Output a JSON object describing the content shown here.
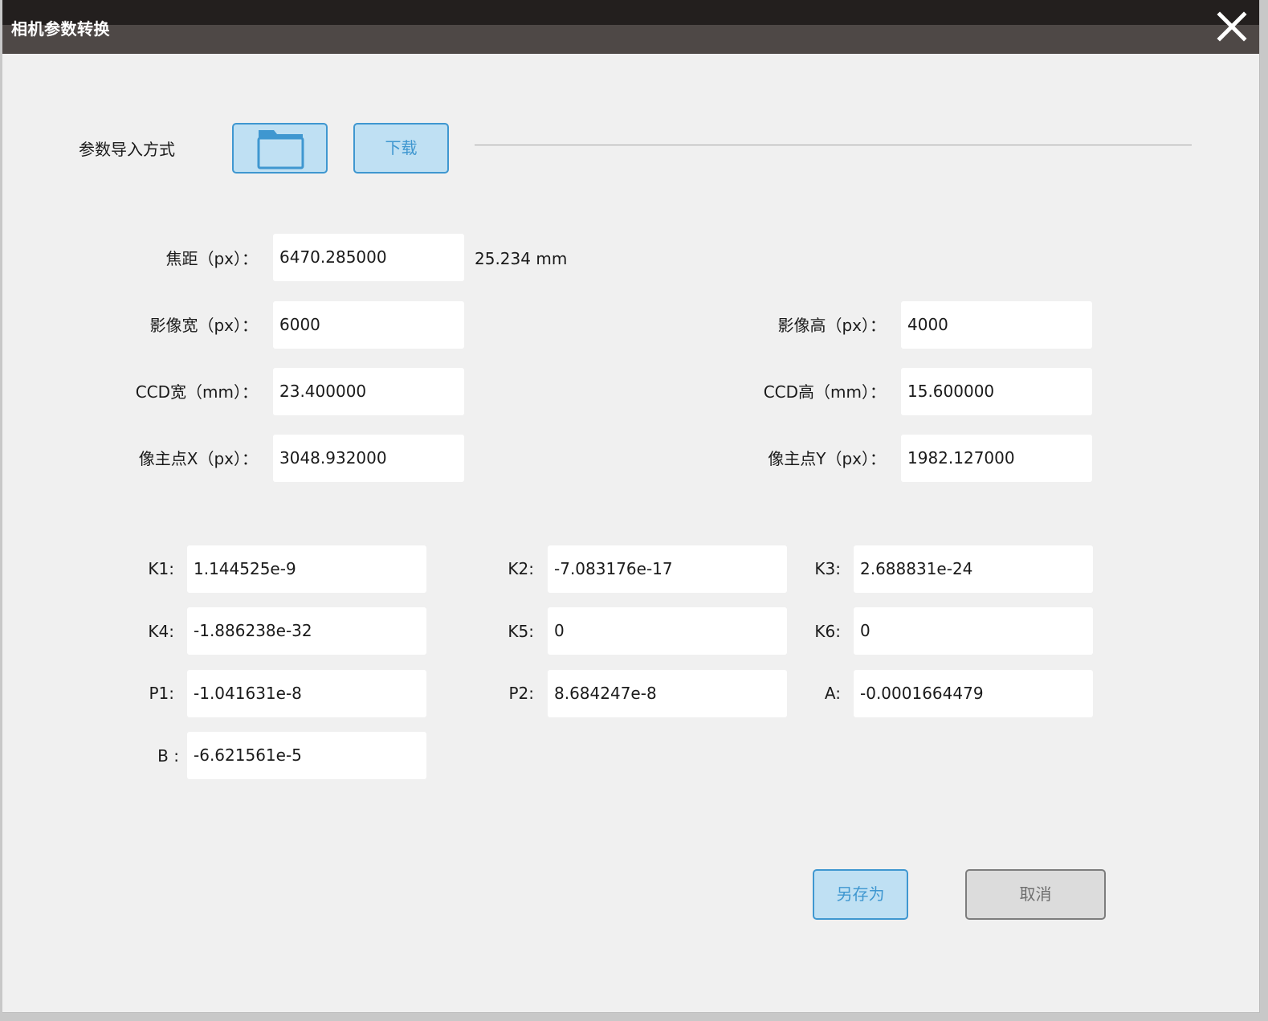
{
  "window": {
    "title": "相机参数转换",
    "close_icon": "close-icon"
  },
  "import": {
    "label": "参数导入方式",
    "folder_icon": "folder-icon",
    "download_label": "下载"
  },
  "camera": {
    "focal_label": "焦距（px）：",
    "focal_value": "6470.285000",
    "focal_mm": "25.234 mm",
    "width_label": "影像宽（px）：",
    "width_value": "6000",
    "height_label": "影像高（px）：",
    "height_value": "4000",
    "ccd_w_label": "CCD宽（mm）：",
    "ccd_w_value": "23.400000",
    "ccd_h_label": "CCD高（mm）：",
    "ccd_h_value": "15.600000",
    "px_label": "像主点X（px）：",
    "px_value": "3048.932000",
    "py_label": "像主点Y（px）：",
    "py_value": "1982.127000"
  },
  "distortion": {
    "k1_label": "K1:",
    "k1_value": "1.144525e-9",
    "k2_label": "K2:",
    "k2_value": "-7.083176e-17",
    "k3_label": "K3:",
    "k3_value": "2.688831e-24",
    "k4_label": "K4:",
    "k4_value": "-1.886238e-32",
    "k5_label": "K5:",
    "k5_value": "0",
    "k6_label": "K6:",
    "k6_value": "0",
    "p1_label": "P1:",
    "p1_value": "-1.041631e-8",
    "p2_label": "P2:",
    "p2_value": "8.684247e-8",
    "a_label": "A:",
    "a_value": "-0.0001664479",
    "b_label": "B :",
    "b_value": "-6.621561e-5"
  },
  "actions": {
    "save_as_label": "另存为",
    "cancel_label": "取消"
  },
  "colors": {
    "accent": "#3f97d0",
    "accent_bg": "#bfe0f3",
    "title_bar": "#4e4846",
    "title_bar_top": "#231f1e",
    "background": "#f0f0f0"
  }
}
